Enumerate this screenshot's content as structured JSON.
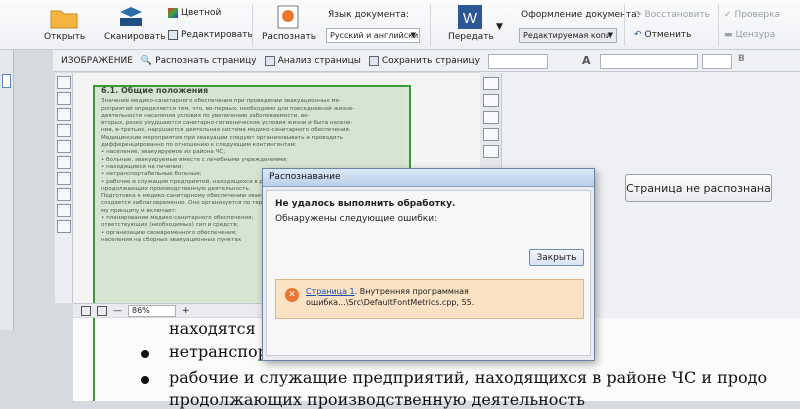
{
  "ribbon": {
    "open": "Открыть",
    "scan": "Сканировать",
    "color": "Цветной",
    "edit": "Редактировать",
    "recognize": "Распознать",
    "doc_lang_label": "Язык документа:",
    "doc_lang_value": "Русский и английски",
    "send": "Передать",
    "doc_format_label": "Оформление документа:",
    "doc_format_value": "Редактируемая копи",
    "restore": "Восстановить",
    "cancel": "Отменить",
    "check": "Проверка",
    "censor": "Цензура"
  },
  "imgbar": {
    "title": "ИЗОБРАЖЕНИЕ",
    "recognize_page": "Распознать страницу",
    "analyze_page": "Анализ страницы",
    "save_page": "Сохранить страницу"
  },
  "scan": {
    "heading": "6.1.  Общие положения",
    "lines": [
      "Значение медико-санитарного обеспечения при проведении эвакуационных ме-",
      "роприятий определяется тем, что, во-первых, необходимо для повседневной жизне-",
      "деятельности населения условия по увеличению заболеваемости, во-",
      "вторых, резко ухудшаются санитарно-гигиенические условия жизни и быта населе-",
      "ния, в-третьих, нарушается деятельная система медико-санитарного обеспечения.",
      "Медицинские мероприятия при эвакуации следуют организовывать и проводить",
      "дифференцированно по отношению к следующим контингентам:",
      "• население, эвакуируемое из района ЧС;",
      "• больные, эвакуируемые вместе с лечебными учреждениями;",
      "• находящиеся на лечении;",
      "• нетранспортабельные больные;",
      "• рабочие и служащие предприятий, находящихся в районе ЧС и",
      "  продолжающих производственную деятельность.",
      "Подготовка к медико-санитарному обеспечению эвакуации населения",
      "создается заблаговременно. Оно организуется по территориально-",
      "му принципу и включает:",
      "• планирование медико-санитарного обеспечения;",
      "  ответствующих (необходимых) сил и средств;",
      "• организацию своевременного обеспечения;",
      "  населения на сборных эвакуационных пунктах"
    ]
  },
  "zoom": {
    "value": "86%",
    "minus": "—",
    "plus": "+"
  },
  "right": {
    "not_recognized": "Страница не распознана"
  },
  "dialog": {
    "title": "Распознавание",
    "failed": "Не удалось выполнить обработку.",
    "errors_found": "Обнаружены следующие ошибки:",
    "close": "Закрыть",
    "err_link": "Страница 1",
    "err_text": ". Внутренняя программная ошибка...\\Src\\DefaultFontMetrics.cpp, 55."
  },
  "textview": {
    "l1": "находятся",
    "l2": "нетранспор",
    "l3": "рабочие и служащие предприятий, находящихся в районе ЧС и продо",
    "l4": "продолжающих производственную деятельность"
  }
}
